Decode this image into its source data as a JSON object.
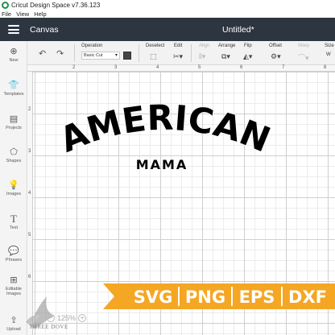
{
  "window": {
    "title": "Cricut Design Space  v7.36.123"
  },
  "menu": {
    "items": [
      "File",
      "View",
      "Help"
    ]
  },
  "header": {
    "canvas_label": "Canvas",
    "document_title": "Untitled*"
  },
  "toolbar": {
    "operation_label": "Operation",
    "operation_value": "Basic Cut",
    "deselect_label": "Deselect",
    "edit_label": "Edit",
    "align_label": "Align",
    "arrange_label": "Arrange",
    "flip_label": "Flip",
    "offset_label": "Offset",
    "warp_label": "Warp",
    "size_label": "Size",
    "size_sub": "W"
  },
  "sidebar": {
    "items": [
      {
        "label": "New",
        "icon": "plus-circle-icon"
      },
      {
        "label": "Templates",
        "icon": "shirt-icon"
      },
      {
        "label": "Projects",
        "icon": "projects-icon"
      },
      {
        "label": "Shapes",
        "icon": "shapes-icon"
      },
      {
        "label": "Images",
        "icon": "lightbulb-icon"
      },
      {
        "label": "Text",
        "icon": "text-icon"
      },
      {
        "label": "Phrases",
        "icon": "speech-bubble-icon"
      },
      {
        "label": "Editable Images",
        "icon": "editable-image-icon"
      },
      {
        "label": "Upload",
        "icon": "upload-icon"
      }
    ]
  },
  "ruler": {
    "top": [
      "2",
      "3",
      "4",
      "5",
      "6",
      "7",
      "8"
    ],
    "left": [
      "2",
      "3",
      "4",
      "5",
      "6"
    ]
  },
  "design": {
    "line1": "AMERICAN",
    "line2": "MAMA"
  },
  "formats": [
    "SVG",
    "PNG",
    "EPS",
    "DXF"
  ],
  "zoom": {
    "level": "125%"
  },
  "watermark": {
    "text": "THREE DOVE"
  },
  "colors": {
    "header": "#2d3540",
    "ribbon": "#f5a623",
    "ribbon_text": "#ffffff",
    "design": "#000000"
  }
}
